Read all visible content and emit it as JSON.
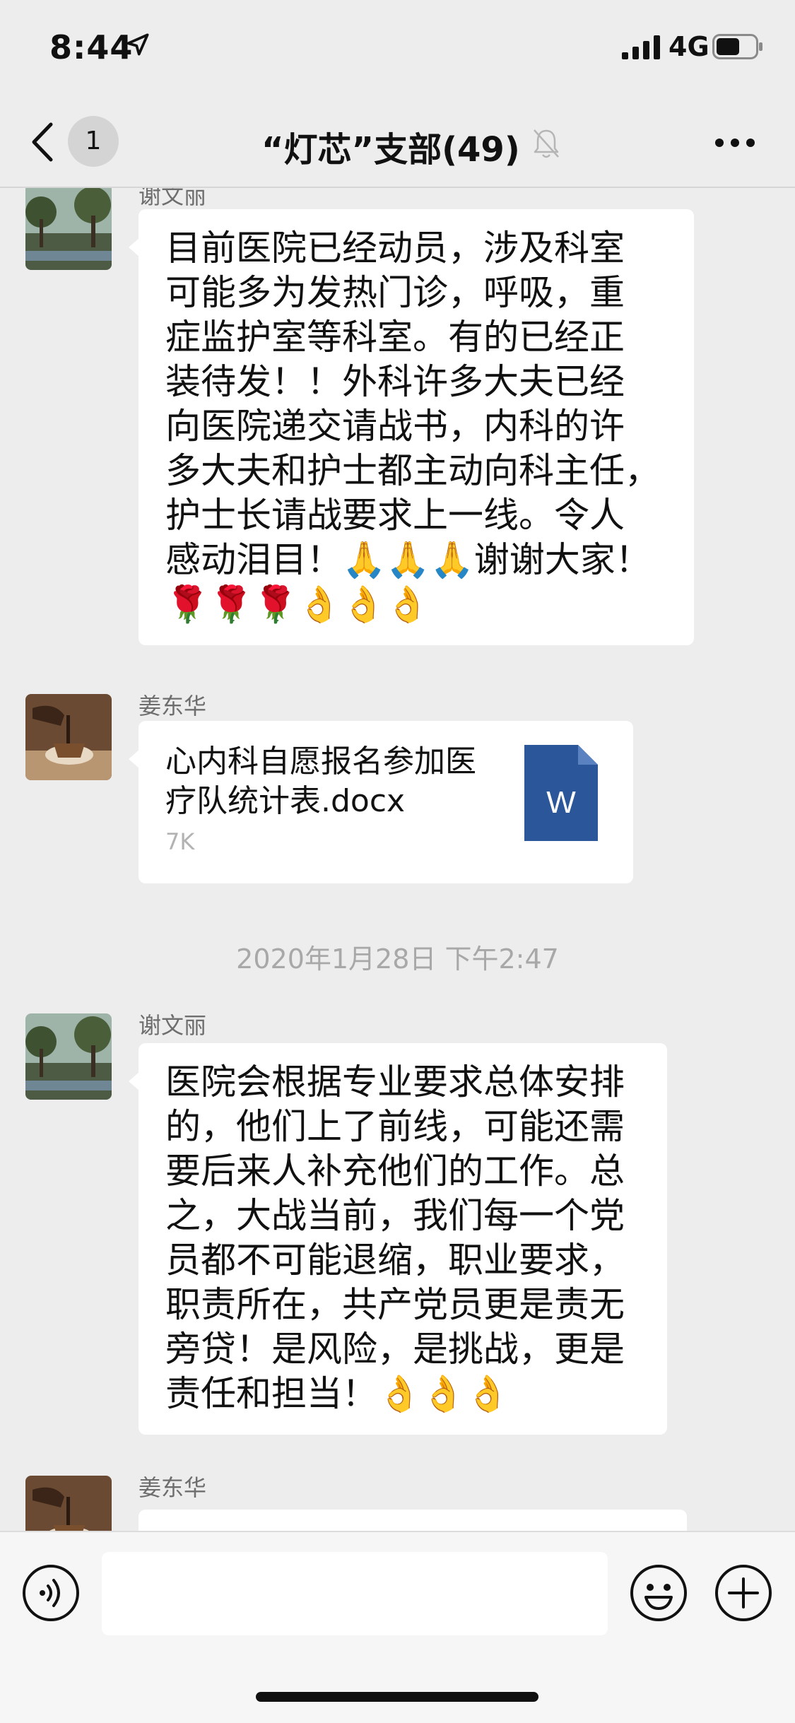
{
  "status_bar": {
    "time": "8:44",
    "network": "4G",
    "battery_level": 0.6
  },
  "nav": {
    "back_badge": "1",
    "title": "“灯芯”支部(49)",
    "icons": [
      "chevron-left-icon",
      "muted-bell-icon",
      "more-dots-icon"
    ]
  },
  "messages": [
    {
      "type": "text",
      "sender": "谢文丽",
      "text": "目前医院已经动员，涉及科室\n可能多为发热门诊，呼吸，重\n症监护室等科室。有的已经正\n装待发！！外科许多大夫已经\n向医院递交请战书，内科的许\n多大夫和护士都主动向科主任，\n护士长请战要求上一线。令人\n感动泪目！🙏🙏🙏谢谢大家！\n🌹🌹🌹👌👌👌"
    },
    {
      "type": "file",
      "sender": "姜东华",
      "file_name": "心内科自愿报名参加医疗队统计表.docx",
      "file_size": "7K",
      "file_icon_letter": "W"
    },
    {
      "type": "timestamp",
      "text": "2020年1月28日 下午2:47"
    },
    {
      "type": "text",
      "sender": "谢文丽",
      "text": "医院会根据专业要求总体安排\n的，他们上了前线，可能还需\n要后来人补充他们的工作。总\n之，大战当前，我们每一个党\n员都不可能退缩，职业要求，\n职责所在，共产党员更是责无\n旁贷！是风险，是挑战，更是\n责任和担当！👌👌👌"
    },
    {
      "type": "text",
      "sender": "姜东华",
      "text": ""
    }
  ],
  "input_bar": {
    "placeholder": "",
    "icons": [
      "voice-icon",
      "emoji-icon",
      "plus-icon"
    ]
  },
  "colors": {
    "background": "#ededed",
    "bubble": "#ffffff",
    "word_blue": "#2b579a"
  }
}
